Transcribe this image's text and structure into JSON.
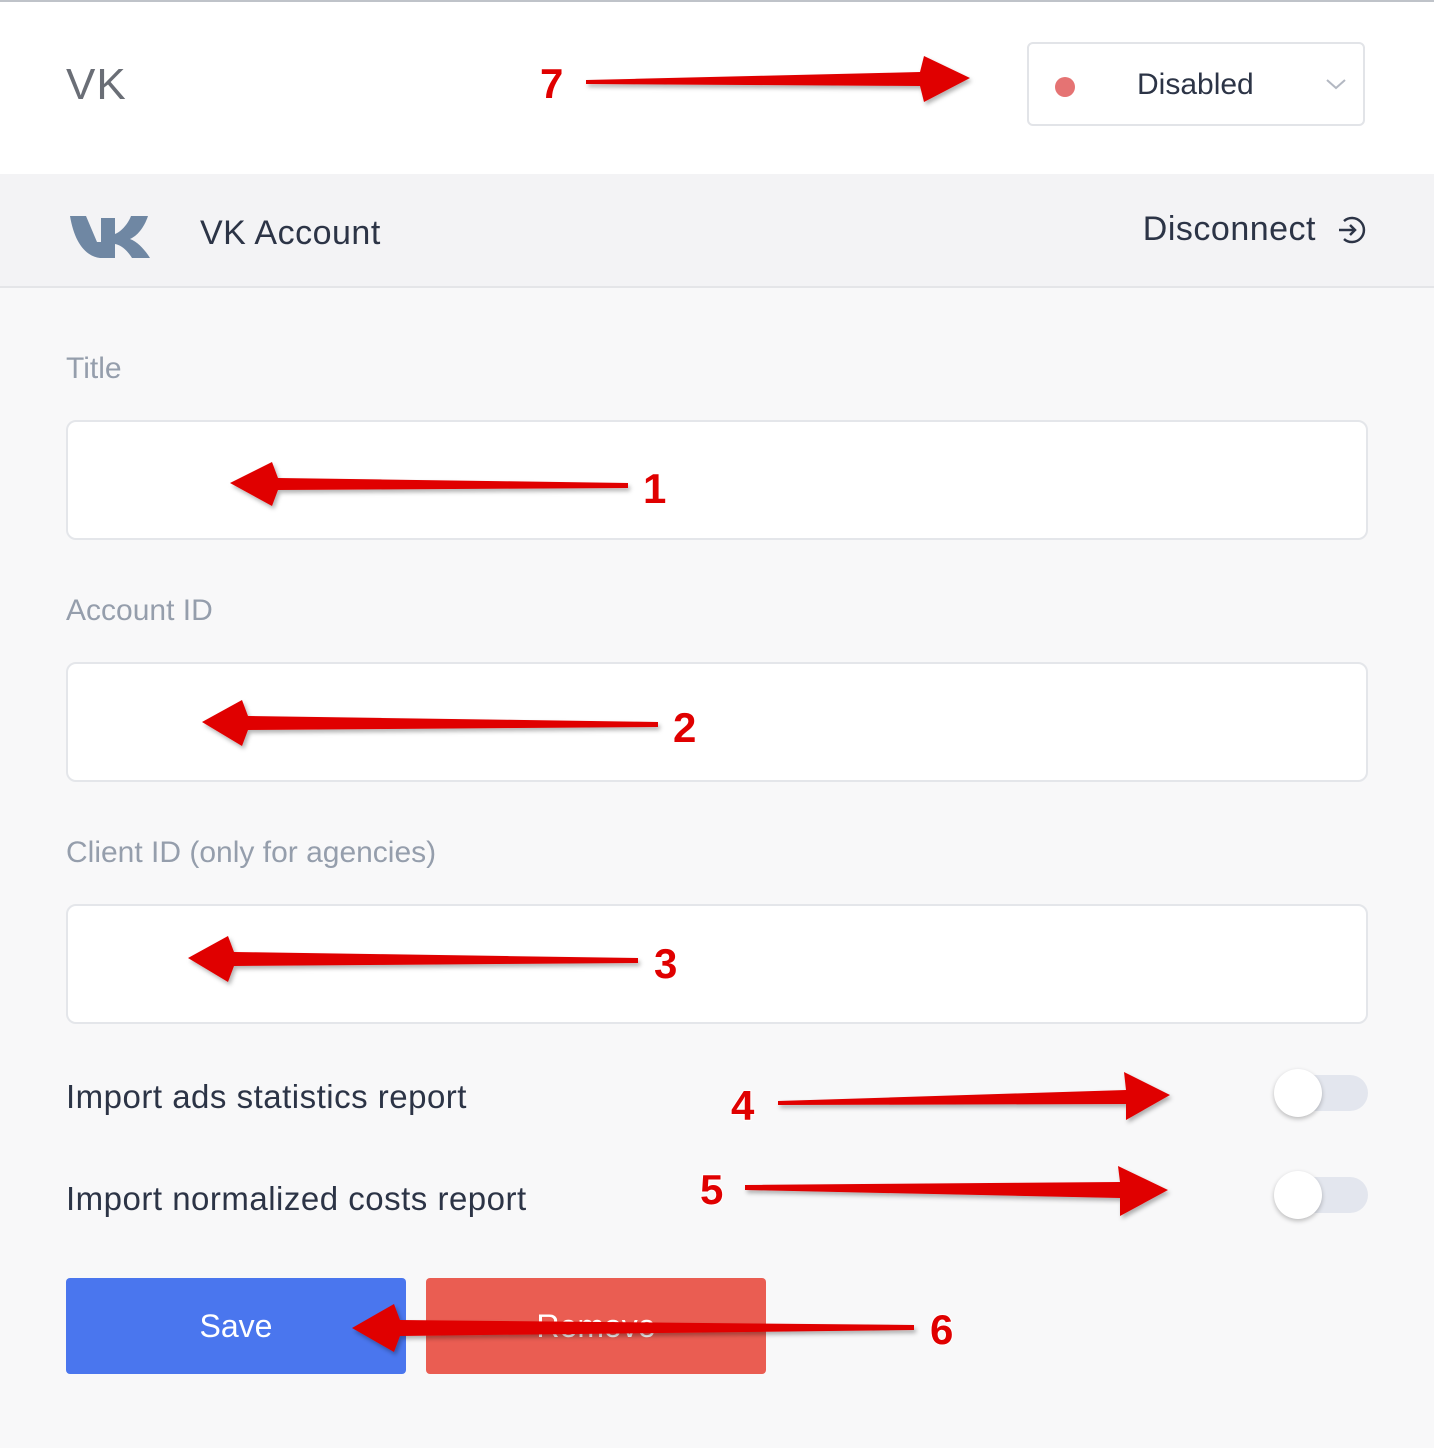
{
  "header": {
    "title": "VK",
    "status": {
      "label": "Disabled",
      "dot_color": "#e57373",
      "icon": "chevron-down-icon"
    }
  },
  "account": {
    "logo": "vk-logo",
    "name": "VK Account",
    "disconnect_label": "Disconnect",
    "disconnect_icon": "sign-out-icon"
  },
  "form": {
    "title": {
      "label": "Title",
      "value": ""
    },
    "account_id": {
      "label": "Account ID",
      "value": ""
    },
    "client_id": {
      "label": "Client ID (only for agencies)",
      "value": ""
    },
    "import_ads": {
      "label": "Import ads statistics report",
      "enabled": false
    },
    "import_costs": {
      "label": "Import normalized costs report",
      "enabled": false
    }
  },
  "actions": {
    "save_label": "Save",
    "remove_label": "Remove"
  },
  "annotations": {
    "color": "#e00000",
    "labels": [
      "1",
      "2",
      "3",
      "4",
      "5",
      "6",
      "7"
    ]
  }
}
